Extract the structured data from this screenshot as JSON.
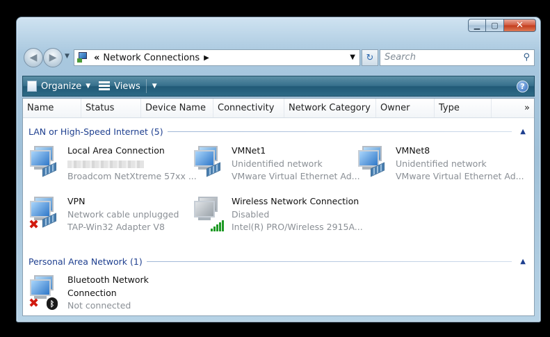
{
  "window": {
    "minimize_icon": "minimize-icon",
    "maximize_icon": "maximize-icon",
    "close_icon": "close-icon"
  },
  "address_bar": {
    "chevron": "«",
    "path": "Network Connections",
    "search_placeholder": "Search"
  },
  "toolbar": {
    "organize_label": "Organize",
    "views_label": "Views",
    "help_label": "?"
  },
  "columns": [
    "Name",
    "Status",
    "Device Name",
    "Connectivity",
    "Network Category",
    "Owner",
    "Type"
  ],
  "columns_more": "»",
  "groups": [
    {
      "title": "LAN or High-Speed Internet (5)",
      "items": [
        {
          "name": "Local Area Connection",
          "status": "",
          "device": "Broadcom NetXtreme 57xx ..."
        },
        {
          "name": "VMNet1",
          "status": "Unidentified network",
          "device": "VMware Virtual Ethernet Ad..."
        },
        {
          "name": "VMNet8",
          "status": "Unidentified network",
          "device": "VMware Virtual Ethernet Ad..."
        },
        {
          "name": "VPN",
          "status": "Network cable unplugged",
          "device": "TAP-Win32 Adapter V8"
        },
        {
          "name": "Wireless Network Connection",
          "status": "Disabled",
          "device": "Intel(R) PRO/Wireless 2915A..."
        }
      ]
    },
    {
      "title": "Personal Area Network (1)",
      "items": [
        {
          "name_line1": "Bluetooth Network",
          "name_line2": "Connection",
          "status": "Not connected"
        }
      ]
    }
  ],
  "colors": {
    "group_header": "#1e3f8f",
    "toolbar": "#2d6a86",
    "subtext": "#8a8f95"
  }
}
